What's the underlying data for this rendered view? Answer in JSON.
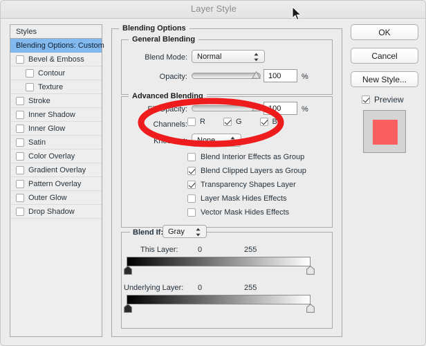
{
  "window": {
    "title": "Layer Style"
  },
  "colors": {
    "selection": "#82b9ef",
    "annotation_red": "#ee1c1c",
    "preview_square": "#f9605f",
    "preview_background": "#d4d4d4",
    "dialog_background": "#ececec"
  },
  "styles_panel": {
    "header_label": "Styles",
    "items": [
      {
        "label": "Blending Options: Custom",
        "selected": true,
        "checkbox": false,
        "checked": false,
        "indent": false
      },
      {
        "label": "Bevel & Emboss",
        "selected": false,
        "checkbox": true,
        "checked": false,
        "indent": false
      },
      {
        "label": "Contour",
        "selected": false,
        "checkbox": true,
        "checked": false,
        "indent": true
      },
      {
        "label": "Texture",
        "selected": false,
        "checkbox": true,
        "checked": false,
        "indent": true
      },
      {
        "label": "Stroke",
        "selected": false,
        "checkbox": true,
        "checked": false,
        "indent": false
      },
      {
        "label": "Inner Shadow",
        "selected": false,
        "checkbox": true,
        "checked": false,
        "indent": false
      },
      {
        "label": "Inner Glow",
        "selected": false,
        "checkbox": true,
        "checked": false,
        "indent": false
      },
      {
        "label": "Satin",
        "selected": false,
        "checkbox": true,
        "checked": false,
        "indent": false
      },
      {
        "label": "Color Overlay",
        "selected": false,
        "checkbox": true,
        "checked": false,
        "indent": false
      },
      {
        "label": "Gradient Overlay",
        "selected": false,
        "checkbox": true,
        "checked": false,
        "indent": false
      },
      {
        "label": "Pattern Overlay",
        "selected": false,
        "checkbox": true,
        "checked": false,
        "indent": false
      },
      {
        "label": "Outer Glow",
        "selected": false,
        "checkbox": true,
        "checked": false,
        "indent": false
      },
      {
        "label": "Drop Shadow",
        "selected": false,
        "checkbox": true,
        "checked": false,
        "indent": false
      }
    ]
  },
  "blending_options": {
    "legend": "Blending Options",
    "general": {
      "legend": "General Blending",
      "blend_mode_label": "Blend Mode:",
      "blend_mode_value": "Normal",
      "opacity_label": "Opacity:",
      "opacity_value": "100",
      "opacity_unit": "%",
      "opacity_percent": 100
    },
    "advanced": {
      "legend": "Advanced Blending",
      "fill_opacity_label": "Fill Opacity:",
      "fill_opacity_value": "100",
      "fill_opacity_unit": "%",
      "fill_opacity_percent": 100,
      "channels_label": "Channels:",
      "channels": [
        {
          "label": "R",
          "checked": false
        },
        {
          "label": "G",
          "checked": true
        },
        {
          "label": "B",
          "checked": true
        }
      ],
      "knockout_label": "Knockout:",
      "knockout_value": "None",
      "options": [
        {
          "label": "Blend Interior Effects as Group",
          "checked": false
        },
        {
          "label": "Blend Clipped Layers as Group",
          "checked": true
        },
        {
          "label": "Transparency Shapes Layer",
          "checked": true
        },
        {
          "label": "Layer Mask Hides Effects",
          "checked": false
        },
        {
          "label": "Vector Mask Hides Effects",
          "checked": false
        }
      ]
    },
    "blend_if": {
      "legend_label": "Blend If:",
      "channel_value": "Gray",
      "this_layer": {
        "label": "This Layer:",
        "min": "0",
        "max": "255"
      },
      "underlying_layer": {
        "label": "Underlying Layer:",
        "min": "0",
        "max": "255"
      }
    }
  },
  "actions": {
    "ok_label": "OK",
    "cancel_label": "Cancel",
    "new_style_label": "New Style...",
    "preview_label": "Preview",
    "preview_checked": true
  }
}
